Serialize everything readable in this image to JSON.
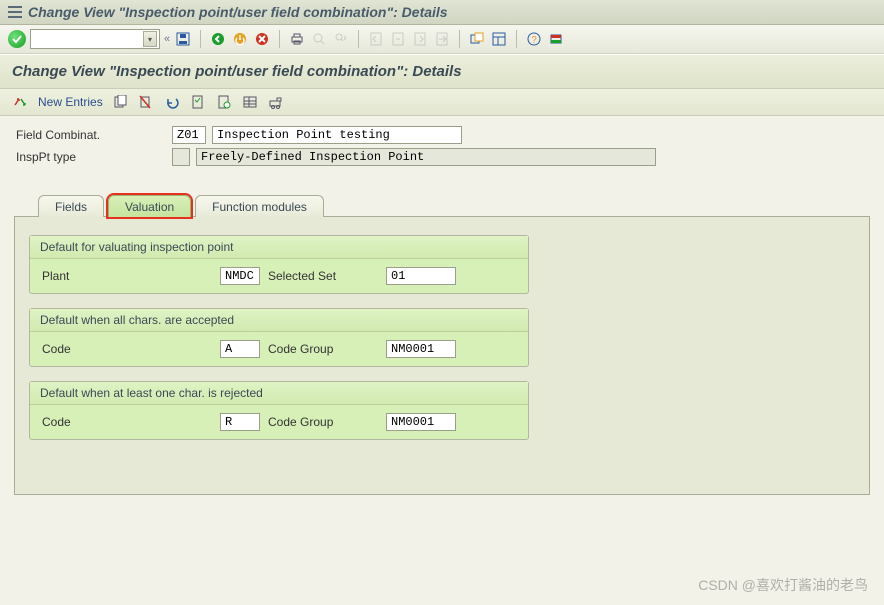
{
  "window_title": "Change View \"Inspection point/user field combination\": Details",
  "header_title": "Change View \"Inspection point/user field combination\": Details",
  "toolbar2": {
    "new_entries": "New Entries"
  },
  "form": {
    "field_combinat_label": "Field Combinat.",
    "field_combinat_code": "Z01",
    "field_combinat_desc": "Inspection Point testing",
    "insppt_type_label": "InspPt type",
    "insppt_type_code": "",
    "insppt_type_desc": "Freely-Defined Inspection Point"
  },
  "tabs": {
    "fields": "Fields",
    "valuation": "Valuation",
    "function_modules": "Function modules"
  },
  "valuation": {
    "group1_title": "Default for valuating inspection point",
    "plant_label": "Plant",
    "plant_value": "NMDC",
    "selected_set_label": "Selected Set",
    "selected_set_value": "01",
    "group2_title": "Default when all chars. are accepted",
    "code_label": "Code",
    "code_accept_value": "A",
    "codegroup_label": "Code Group",
    "codegroup_accept_value": "NM0001",
    "group3_title": "Default when at least one char. is rejected",
    "code_reject_value": "R",
    "codegroup_reject_value": "NM0001"
  },
  "watermark": "CSDN @喜欢打酱油的老鸟"
}
